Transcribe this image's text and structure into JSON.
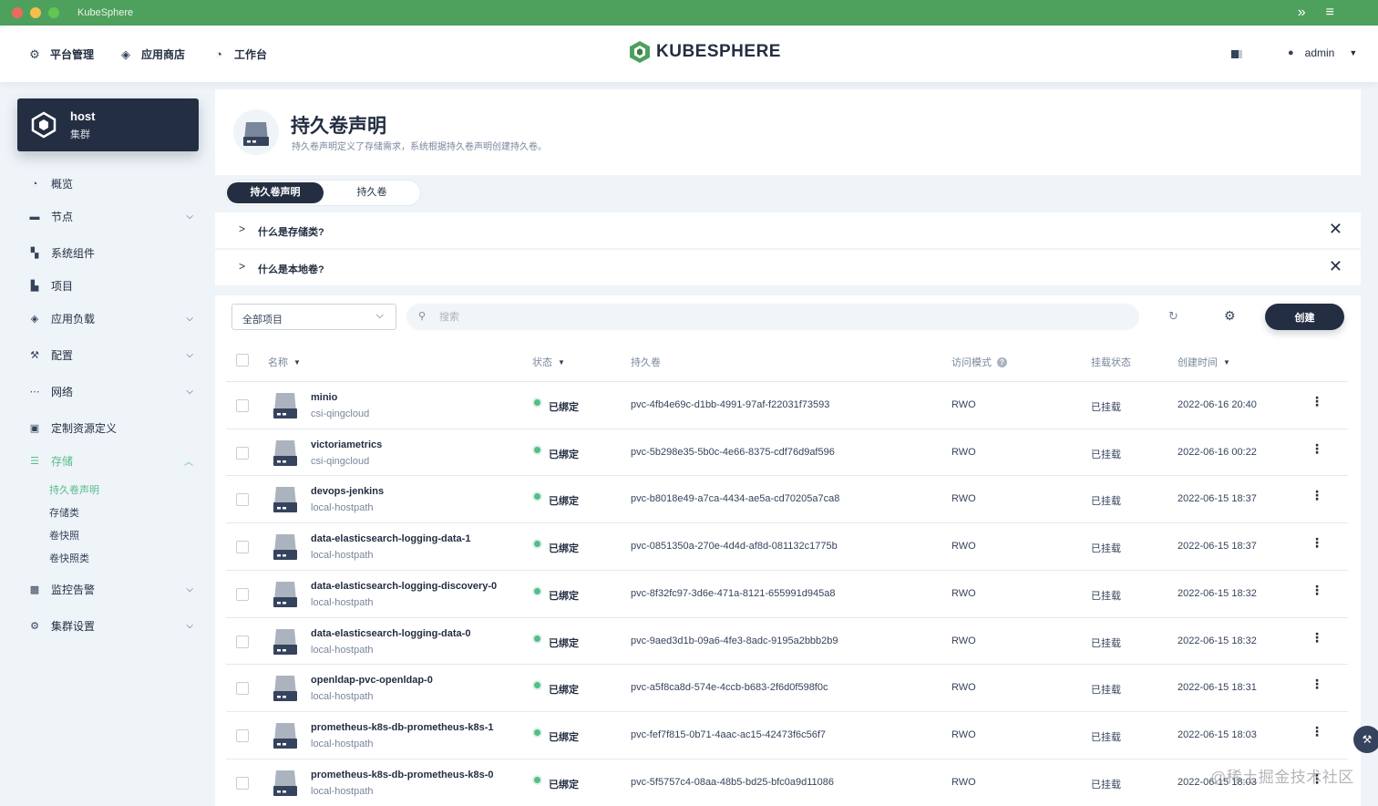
{
  "window": {
    "title": "KubeSphere"
  },
  "topnav": {
    "items": [
      {
        "label": "平台管理",
        "icon": "gear-icon"
      },
      {
        "label": "应用商店",
        "icon": "stack-icon"
      },
      {
        "label": "工作台",
        "icon": "dashboard-icon"
      }
    ],
    "logo_text": "KUBESPHERE",
    "user": "admin"
  },
  "cluster": {
    "name": "host",
    "type": "集群"
  },
  "sidebar": {
    "items": [
      {
        "label": "概览",
        "icon": "dashboard-icon",
        "expandable": false
      },
      {
        "label": "节点",
        "icon": "server-icon",
        "expandable": true
      },
      {
        "label": "系统组件",
        "icon": "components-icon",
        "expandable": false
      },
      {
        "label": "项目",
        "icon": "project-icon",
        "expandable": false
      },
      {
        "label": "应用负载",
        "icon": "stack-icon",
        "expandable": true
      },
      {
        "label": "配置",
        "icon": "hammer-icon",
        "expandable": true
      },
      {
        "label": "网络",
        "icon": "network-icon",
        "expandable": true
      },
      {
        "label": "定制资源定义",
        "icon": "crd-icon",
        "expandable": false
      },
      {
        "label": "存储",
        "icon": "database-icon",
        "expandable": true,
        "expanded": true
      },
      {
        "label": "监控告警",
        "icon": "monitor-icon",
        "expandable": true
      },
      {
        "label": "集群设置",
        "icon": "gear-icon",
        "expandable": true
      }
    ],
    "storage_sub": [
      "持久卷声明",
      "存储类",
      "卷快照",
      "卷快照类"
    ]
  },
  "header": {
    "title": "持久卷声明",
    "description": "持久卷声明定义了存储需求，系统根据持久卷声明创建持久卷。"
  },
  "tabs": [
    "持久卷声明",
    "持久卷"
  ],
  "faq": [
    "什么是存储类?",
    "什么是本地卷?"
  ],
  "toolbar": {
    "project_select": "全部项目",
    "search_placeholder": "搜索",
    "create_label": "创建"
  },
  "table": {
    "columns": {
      "name": "名称",
      "status": "状态",
      "pv": "持久卷",
      "access_mode": "访问模式",
      "mount": "挂载状态",
      "created": "创建时间"
    },
    "rows": [
      {
        "name": "minio",
        "storage_class": "csi-qingcloud",
        "status": "已绑定",
        "pv": "pvc-4fb4e69c-d1bb-4991-97af-f22031f73593",
        "mode": "RWO",
        "mount": "已挂载",
        "created": "2022-06-16 20:40"
      },
      {
        "name": "victoriametrics",
        "storage_class": "csi-qingcloud",
        "status": "已绑定",
        "pv": "pvc-5b298e35-5b0c-4e66-8375-cdf76d9af596",
        "mode": "RWO",
        "mount": "已挂载",
        "created": "2022-06-16 00:22"
      },
      {
        "name": "devops-jenkins",
        "storage_class": "local-hostpath",
        "status": "已绑定",
        "pv": "pvc-b8018e49-a7ca-4434-ae5a-cd70205a7ca8",
        "mode": "RWO",
        "mount": "已挂载",
        "created": "2022-06-15 18:37"
      },
      {
        "name": "data-elasticsearch-logging-data-1",
        "storage_class": "local-hostpath",
        "status": "已绑定",
        "pv": "pvc-0851350a-270e-4d4d-af8d-081132c1775b",
        "mode": "RWO",
        "mount": "已挂载",
        "created": "2022-06-15 18:37"
      },
      {
        "name": "data-elasticsearch-logging-discovery-0",
        "storage_class": "local-hostpath",
        "status": "已绑定",
        "pv": "pvc-8f32fc97-3d6e-471a-8121-655991d945a8",
        "mode": "RWO",
        "mount": "已挂载",
        "created": "2022-06-15 18:32"
      },
      {
        "name": "data-elasticsearch-logging-data-0",
        "storage_class": "local-hostpath",
        "status": "已绑定",
        "pv": "pvc-9aed3d1b-09a6-4fe3-8adc-9195a2bbb2b9",
        "mode": "RWO",
        "mount": "已挂载",
        "created": "2022-06-15 18:32"
      },
      {
        "name": "openldap-pvc-openldap-0",
        "storage_class": "local-hostpath",
        "status": "已绑定",
        "pv": "pvc-a5f8ca8d-574e-4ccb-b683-2f6d0f598f0c",
        "mode": "RWO",
        "mount": "已挂载",
        "created": "2022-06-15 18:31"
      },
      {
        "name": "prometheus-k8s-db-prometheus-k8s-1",
        "storage_class": "local-hostpath",
        "status": "已绑定",
        "pv": "pvc-fef7f815-0b71-4aac-ac15-42473f6c56f7",
        "mode": "RWO",
        "mount": "已挂载",
        "created": "2022-06-15 18:03"
      },
      {
        "name": "prometheus-k8s-db-prometheus-k8s-0",
        "storage_class": "local-hostpath",
        "status": "已绑定",
        "pv": "pvc-5f5757c4-08aa-48b5-bd25-bfc0a9d11086",
        "mode": "RWO",
        "mount": "已挂载",
        "created": "2022-06-15 18:03"
      }
    ]
  },
  "watermark": "@稀土掘金技术社区",
  "colors": {
    "titlebar": "#4ea15d",
    "dark": "#242e42",
    "accent": "#55bc8a",
    "background": "#eff4f9"
  }
}
